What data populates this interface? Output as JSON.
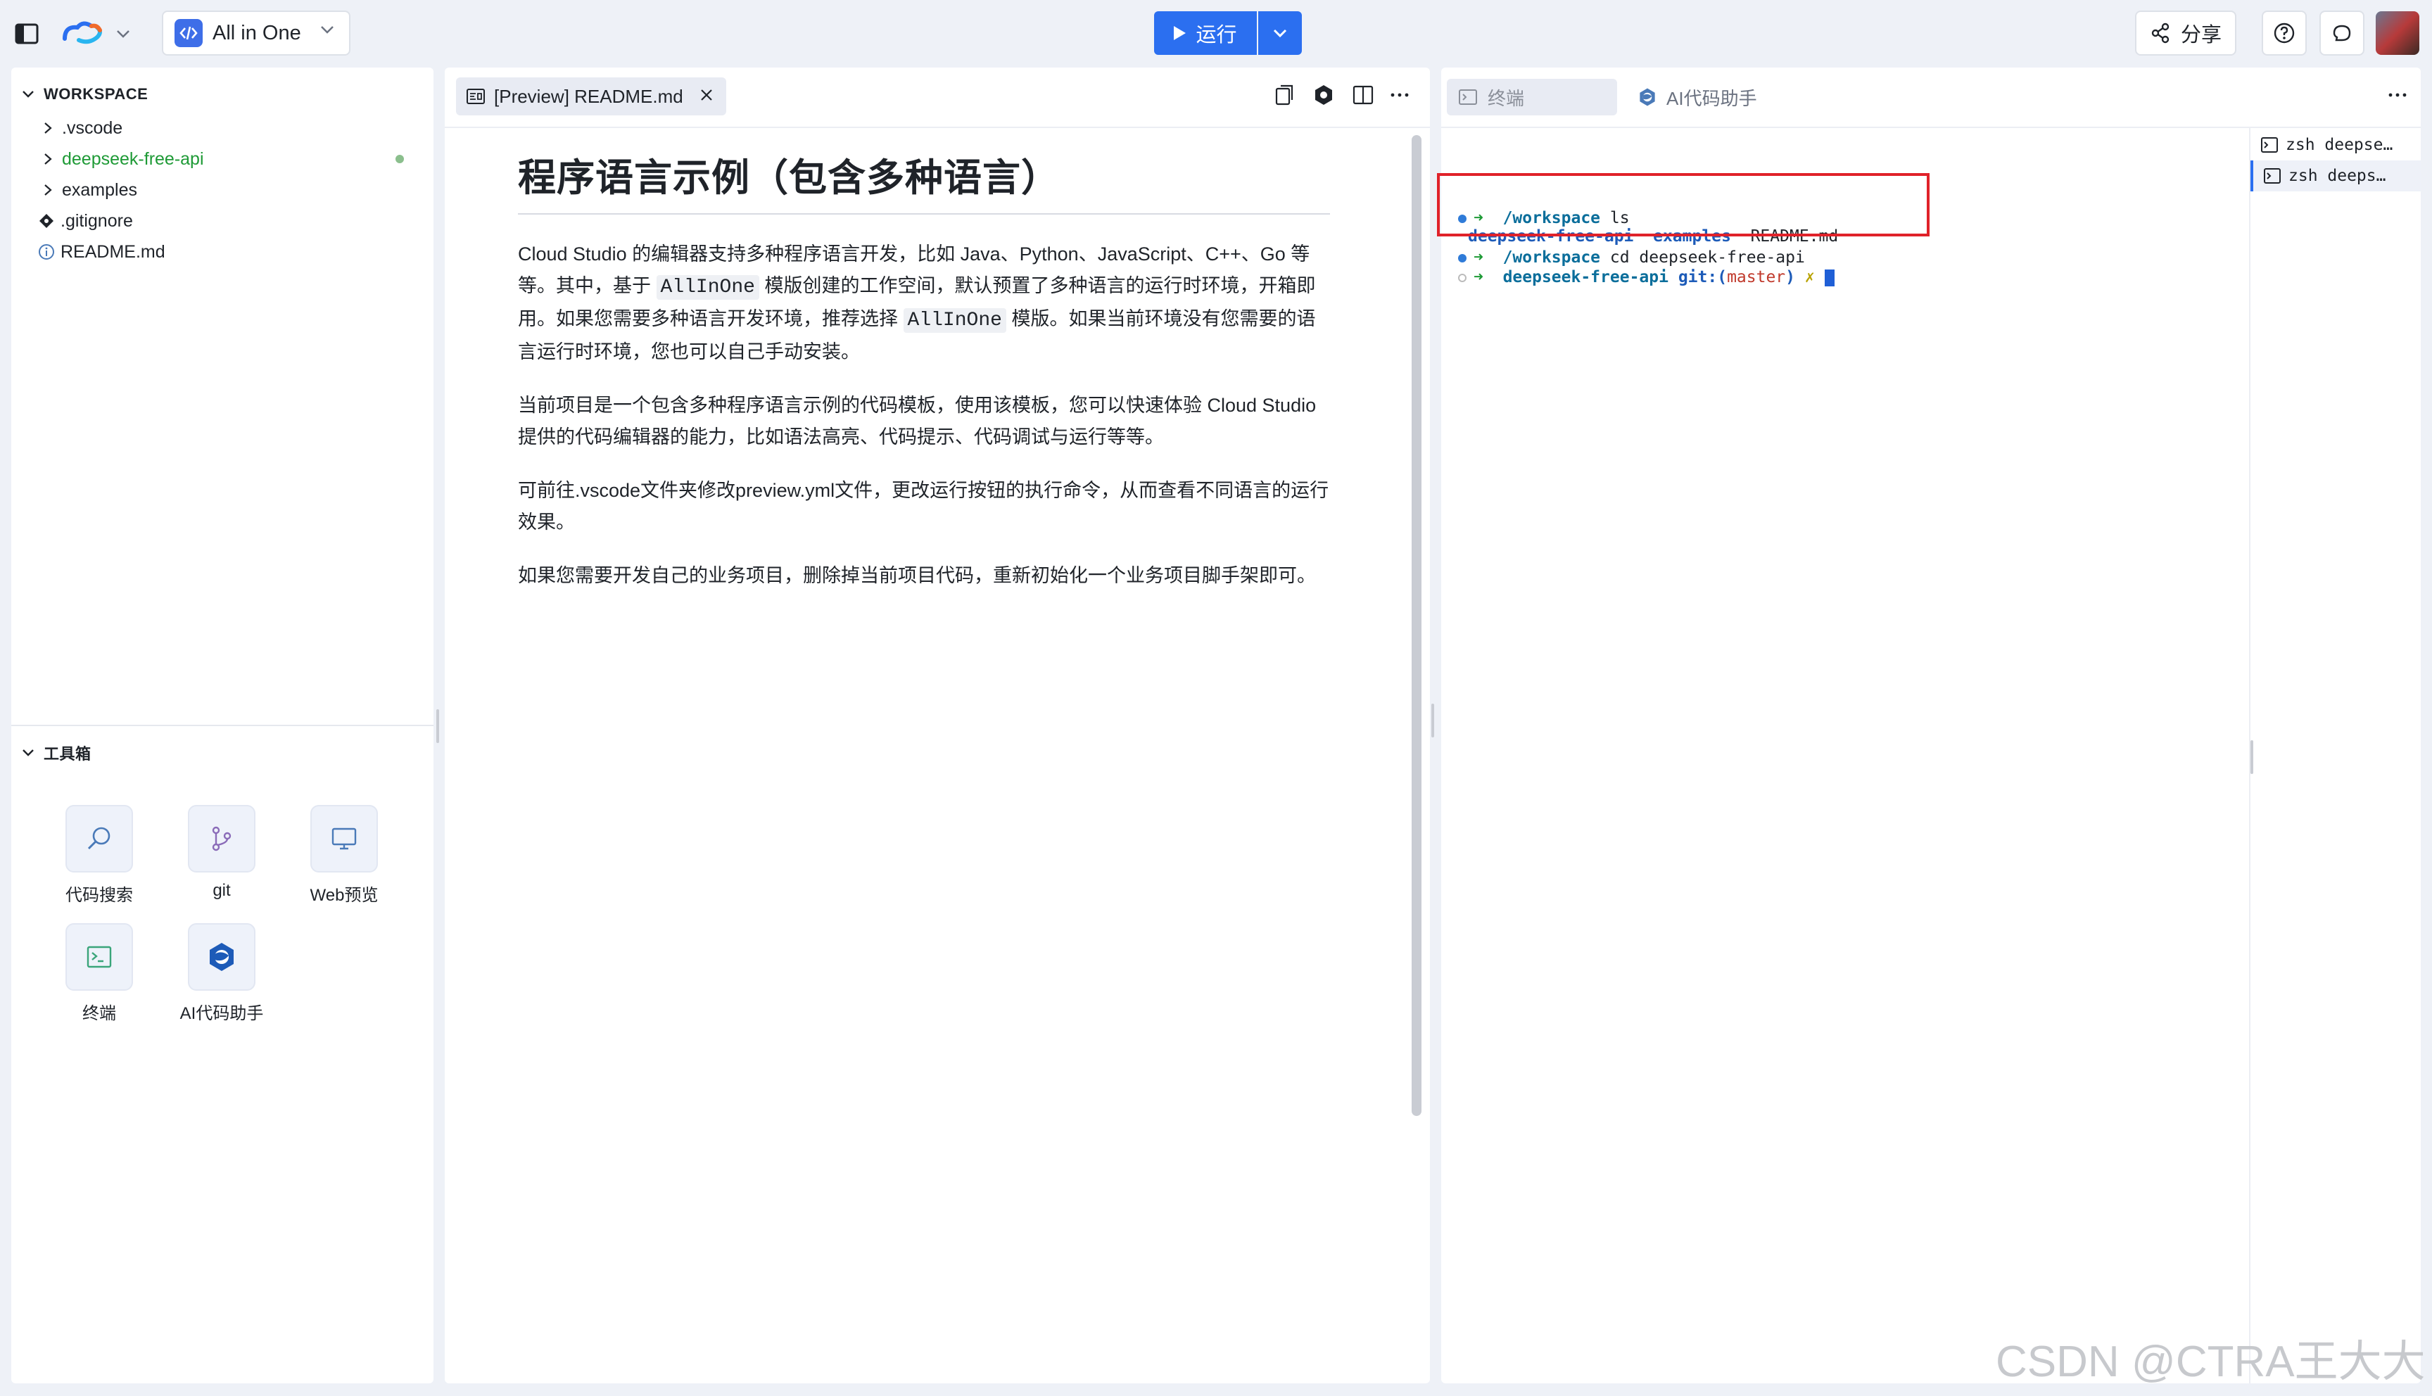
{
  "topbar": {
    "project_name": "All in One",
    "run_label": "运行",
    "share_label": "分享"
  },
  "explorer": {
    "section_title": "WORKSPACE",
    "items": [
      {
        "label": ".vscode",
        "type": "folder"
      },
      {
        "label": "deepseek-free-api",
        "type": "folder",
        "active": true,
        "modified": true
      },
      {
        "label": "examples",
        "type": "folder"
      },
      {
        "label": ".gitignore",
        "type": "file"
      },
      {
        "label": "README.md",
        "type": "file"
      }
    ]
  },
  "toolbox": {
    "section_title": "工具箱",
    "tools": [
      {
        "label": "代码搜索",
        "icon": "search-icon"
      },
      {
        "label": "git",
        "icon": "git-branch-icon"
      },
      {
        "label": "Web预览",
        "icon": "monitor-icon"
      },
      {
        "label": "终端",
        "icon": "terminal-icon"
      },
      {
        "label": "AI代码助手",
        "icon": "ai-assistant-icon"
      }
    ]
  },
  "editor": {
    "tab_label": "[Preview] README.md",
    "heading": "程序语言示例（包含多种语言）",
    "paragraphs": {
      "p1_a": "Cloud Studio 的编辑器支持多种程序语言开发，比如 Java、Python、JavaScript、C++、Go 等等。其中，基于 ",
      "p1_code1": "AllInOne",
      "p1_b": " 模版创建的工作空间，默认预置了多种语言的运行时环境，开箱即用。如果您需要多种语言开发环境，推荐选择 ",
      "p1_code2": "AllInOne",
      "p1_c": " 模版。如果当前环境没有您需要的语言运行时环境，您也可以自己手动安装。",
      "p2": "当前项目是一个包含多种程序语言示例的代码模板，使用该模板，您可以快速体验 Cloud Studio 提供的代码编辑器的能力，比如语法高亮、代码提示、代码调试与运行等等。",
      "p3": "可前往.vscode文件夹修改preview.yml文件，更改运行按钮的执行命令，从而查看不同语言的运行效果。",
      "p4": "如果您需要开发自己的业务项目，删除掉当前项目代码，重新初始化一个业务项目脚手架即可。"
    }
  },
  "terminal": {
    "tabs": [
      {
        "label": "终端"
      },
      {
        "label": "AI代码助手"
      }
    ],
    "lines": {
      "l1_dir": "/workspace",
      "l1_cmd": " ls",
      "l2_a": "deepseek-free-api",
      "l2_b": "  examples",
      "l2_c": "  README.md",
      "l3_dir": "/workspace",
      "l3_cmd": " cd deepseek-free-api",
      "l4_dir": "deepseek-free-api",
      "l4_git": " git:(",
      "l4_branch": "master",
      "l4_close": ")",
      "l4_x": " ✗",
      "arrow": "➜"
    },
    "sessions": [
      "zsh deepse…",
      "zsh deeps…"
    ]
  },
  "watermark": "CSDN @CTRA王大大",
  "colors": {
    "accent": "#2b6ff0",
    "highlight_box": "#e0222a",
    "active_file": "#1e9a36"
  }
}
